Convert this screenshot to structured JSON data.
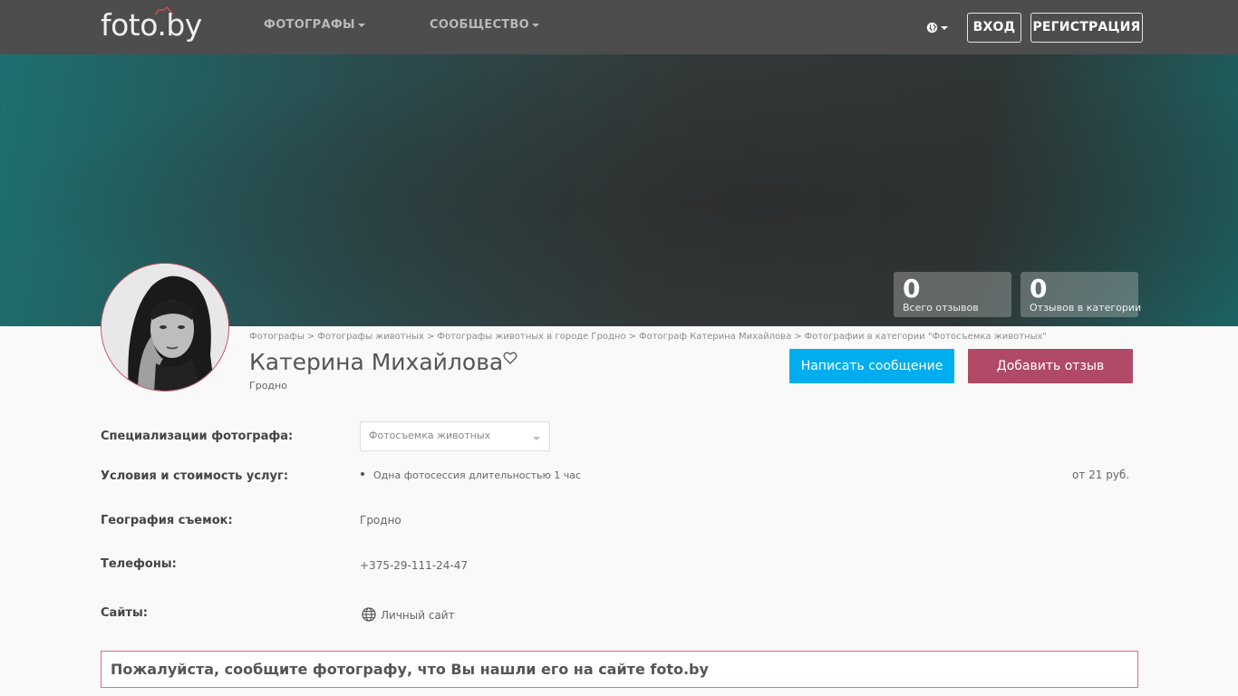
{
  "navbar": {
    "logo_text": "foto.by",
    "menu_photographers": "ФОТОГРАФЫ",
    "menu_community": "СООБЩЕСТВО",
    "login": "ВХОД",
    "register": "РЕГИСТРАЦИЯ"
  },
  "stats": [
    {
      "value": "0",
      "label": "Всего отзывов"
    },
    {
      "value": "0",
      "label": "Отзывов в категории"
    }
  ],
  "breadcrumb": [
    "Фотографы",
    "Фотографы животных",
    "Фотографы животных в городе Гродно",
    "Фотограф Катерина Михайлова",
    "Фотографии в категории \"Фотосъемка животных\""
  ],
  "breadcrumb_separator": ">",
  "profile": {
    "name": "Катерина Михайлова",
    "city": "Гродно"
  },
  "actions": {
    "message": "Написать сообщение",
    "review": "Добавить отзыв"
  },
  "info": {
    "specialization_label": "Специализации фотографа:",
    "specialization_value": "Фотосъемка животных",
    "services_label": "Условия и стоимость услуг:",
    "service_item": "Одна фотосессия длительностью 1 час",
    "service_price": "от 21 руб.",
    "geo_label": "География съемок:",
    "geo_value": "Гродно",
    "phones_label": "Телефоны:",
    "phone_value": "+375-29-111-24-47",
    "sites_label": "Сайты:",
    "site_value": "Личный сайт"
  },
  "notice": "Пожалуйста, сообщите фотографу, что Вы нашли его на сайте foto.by",
  "colors": {
    "navbar": "#4d4d4d",
    "message_button": "#00aef0",
    "review_button": "#b04a66",
    "logo_accent": "#c94a5b"
  }
}
